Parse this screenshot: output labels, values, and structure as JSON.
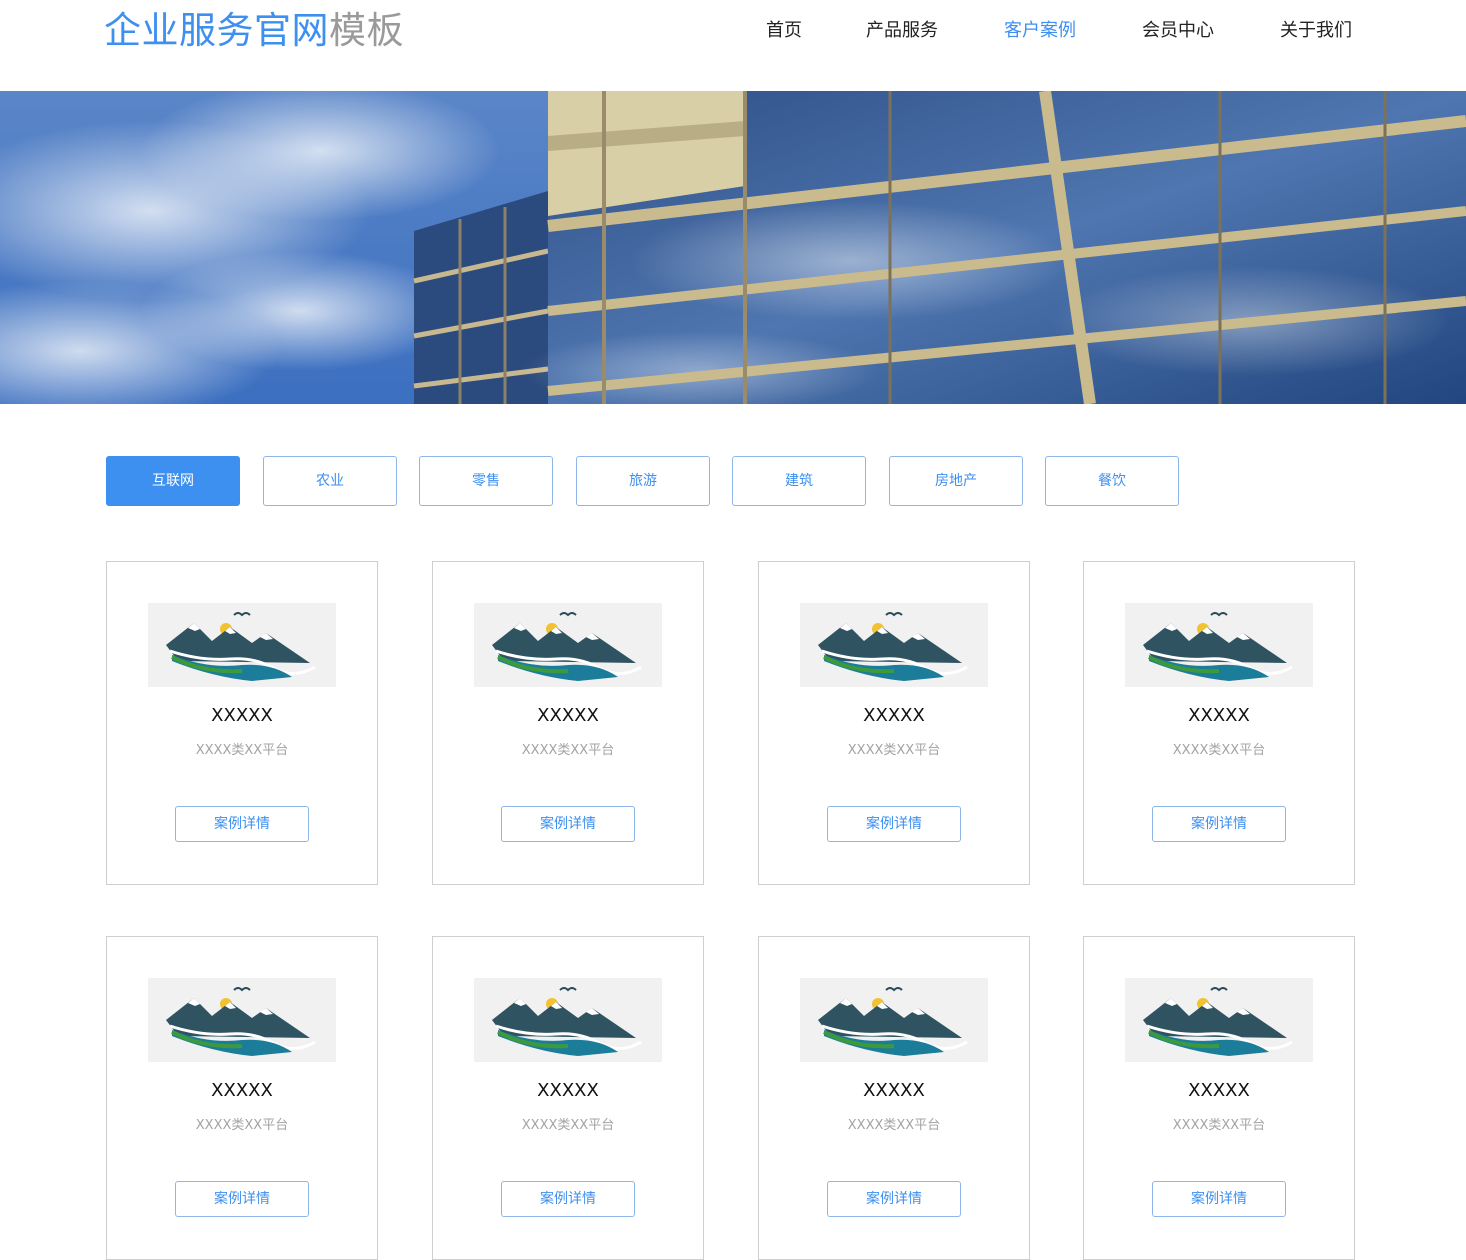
{
  "header": {
    "logo_primary": "企业服务官网",
    "logo_secondary": "模板",
    "nav": [
      {
        "label": "首页"
      },
      {
        "label": "产品服务"
      },
      {
        "label": "客户案例",
        "active": true
      },
      {
        "label": "会员中心"
      },
      {
        "label": "关于我们"
      }
    ]
  },
  "colors": {
    "accent": "#3d8ff0",
    "muted": "#9a9a9a"
  },
  "tabs": [
    {
      "label": "互联网",
      "active": true
    },
    {
      "label": "农业"
    },
    {
      "label": "零售"
    },
    {
      "label": "旅游"
    },
    {
      "label": "建筑"
    },
    {
      "label": "房地产"
    },
    {
      "label": "餐饮"
    }
  ],
  "cases": [
    {
      "title": "XXXXX",
      "desc": "XXXX类XX平台",
      "button": "案例详情"
    },
    {
      "title": "XXXXX",
      "desc": "XXXX类XX平台",
      "button": "案例详情"
    },
    {
      "title": "XXXXX",
      "desc": "XXXX类XX平台",
      "button": "案例详情"
    },
    {
      "title": "XXXXX",
      "desc": "XXXX类XX平台",
      "button": "案例详情"
    },
    {
      "title": "XXXXX",
      "desc": "XXXX类XX平台",
      "button": "案例详情"
    },
    {
      "title": "XXXXX",
      "desc": "XXXX类XX平台",
      "button": "案例详情"
    },
    {
      "title": "XXXXX",
      "desc": "XXXX类XX平台",
      "button": "案例详情"
    },
    {
      "title": "XXXXX",
      "desc": "XXXX类XX平台",
      "button": "案例详情"
    }
  ]
}
